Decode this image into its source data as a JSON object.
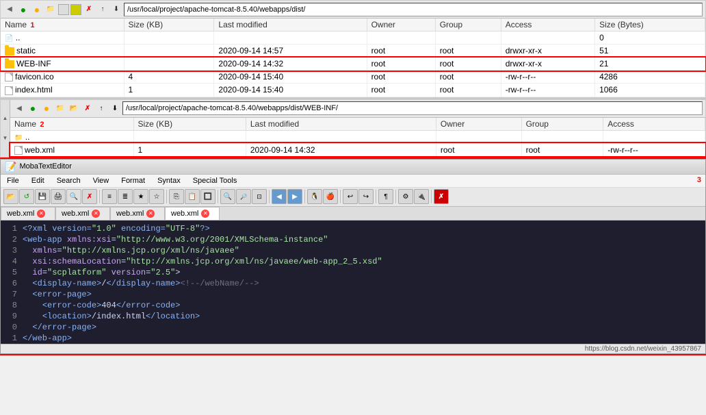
{
  "panel1": {
    "address": "/usr/local/project/apache-tomcat-8.5.40/webapps/dist/",
    "number": "1",
    "columns": [
      "Name",
      "Size (KB)",
      "Last modified",
      "Owner",
      "Group",
      "Access",
      "Size (Bytes)"
    ],
    "rows": [
      {
        "name": "..",
        "size": "",
        "modified": "",
        "owner": "",
        "group": "",
        "access": "",
        "bytes": "0",
        "type": "parent"
      },
      {
        "name": "static",
        "size": "",
        "modified": "2020-09-14 14:57",
        "owner": "root",
        "group": "root",
        "access": "drwxr-xr-x",
        "bytes": "51",
        "type": "folder"
      },
      {
        "name": "WEB-INF",
        "size": "",
        "modified": "2020-09-14 14:32",
        "owner": "root",
        "group": "root",
        "access": "drwxr-xr-x",
        "bytes": "21",
        "type": "folder",
        "highlighted": true
      },
      {
        "name": "favicon.ico",
        "size": "4",
        "modified": "2020-09-14 15:40",
        "owner": "root",
        "group": "root",
        "access": "-rw-r--r--",
        "bytes": "4286",
        "type": "file"
      },
      {
        "name": "index.html",
        "size": "1",
        "modified": "2020-09-14 15:40",
        "owner": "root",
        "group": "root",
        "access": "-rw-r--r--",
        "bytes": "1066",
        "type": "file"
      }
    ]
  },
  "panel2": {
    "address": "/usr/local/project/apache-tomcat-8.5.40/webapps/dist/WEB-INF/",
    "number": "2",
    "columns": [
      "Name",
      "Size (KB)",
      "Last modified",
      "Owner",
      "Group",
      "Access"
    ],
    "rows": [
      {
        "name": "..",
        "size": "",
        "modified": "",
        "owner": "",
        "group": "",
        "access": "",
        "type": "parent"
      },
      {
        "name": "web.xml",
        "size": "1",
        "modified": "2020-09-14 14:32",
        "owner": "root",
        "group": "root",
        "access": "-rw-r--r--",
        "type": "file",
        "highlighted": true
      }
    ]
  },
  "editor": {
    "title": "MobaTextEditor",
    "number": "3",
    "menu": [
      "File",
      "Edit",
      "Search",
      "View",
      "Format",
      "Syntax",
      "Special Tools"
    ],
    "tabs": [
      {
        "label": "web.xml",
        "active": false
      },
      {
        "label": "web.xml",
        "active": false
      },
      {
        "label": "web.xml",
        "active": false
      },
      {
        "label": "web.xml",
        "active": true
      }
    ],
    "code_lines": [
      {
        "num": "1",
        "content": "<?xml version=\"1.0\" encoding=\"UTF-8\"?>",
        "class": "xml-tag"
      },
      {
        "num": "2",
        "content": "<web-app xmlns:xsi=\"http://www.w3.org/2001/XMLSchema-instance\""
      },
      {
        "num": "3",
        "content": "  xmlns=\"http://xmlns.jcp.org/xml/ns/javaee\""
      },
      {
        "num": "4",
        "content": "  xsi:schemaLocation=\"http://xmlns.jcp.org/xml/ns/javaee/web-app_2_5.xsd\""
      },
      {
        "num": "5",
        "content": "  id=\"scplatform\" version=\"2.5\">"
      },
      {
        "num": "6",
        "content": "  <display-name>/</display-name><!--/webName/-->"
      },
      {
        "num": "7",
        "content": "  <error-page>"
      },
      {
        "num": "8",
        "content": "    <error-code>404</error-code>"
      },
      {
        "num": "9",
        "content": "    <location>/index.html</location>"
      },
      {
        "num": "0",
        "content": "  </error-page>"
      },
      {
        "num": "1",
        "content": "</web-app>"
      }
    ]
  },
  "status": {
    "url": "https://blog.csdn.net/weixin_43957867"
  },
  "toolbar_icons": {
    "back": "◀",
    "forward": "▶",
    "up": "▲",
    "refresh": "↺",
    "home": "⌂",
    "new_folder": "📁",
    "delete": "✗",
    "copy": "⎘",
    "paste": "📋"
  }
}
